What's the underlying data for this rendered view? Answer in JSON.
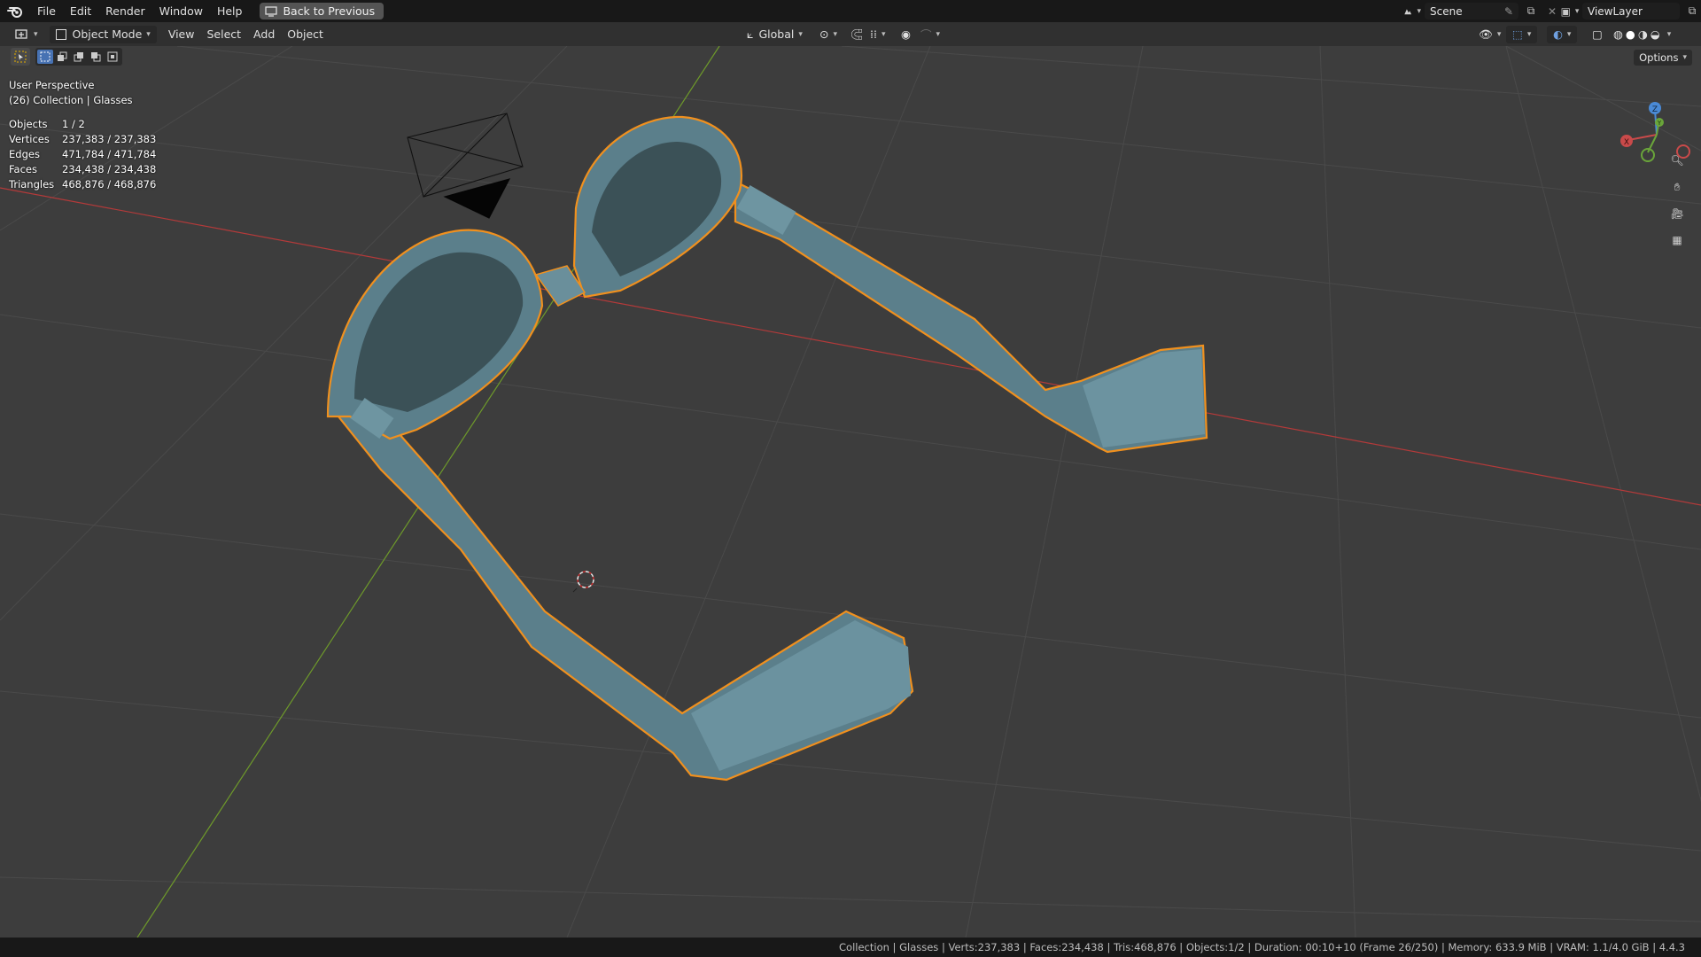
{
  "topbar": {
    "menu": [
      "File",
      "Edit",
      "Render",
      "Window",
      "Help"
    ],
    "back_label": "Back to Previous",
    "scene_label": "Scene",
    "viewlayer_label": "ViewLayer"
  },
  "header": {
    "mode_label": "Object Mode",
    "menus": [
      "View",
      "Select",
      "Add",
      "Object"
    ],
    "transform_orientation": "Global",
    "options_label": "Options"
  },
  "overlay": {
    "perspective": "User Perspective",
    "collection": "(26) Collection | Glasses",
    "stats": [
      {
        "key": "Objects",
        "value": "1 / 2"
      },
      {
        "key": "Vertices",
        "value": "237,383 / 237,383"
      },
      {
        "key": "Edges",
        "value": "471,784 / 471,784"
      },
      {
        "key": "Faces",
        "value": "234,438 / 234,438"
      },
      {
        "key": "Triangles",
        "value": "468,876 / 468,876"
      }
    ]
  },
  "gizmo": {
    "x_label": "X",
    "y_label": "Y",
    "z_label": "Z"
  },
  "status": {
    "text": "Collection | Glasses | Verts:237,383 | Faces:234,438 | Tris:468,876 | Objects:1/2 | Duration: 00:10+10 (Frame 26/250) | Memory: 633.9 MiB | VRAM: 1.1/4.0 GiB | 4.4.3"
  },
  "colors": {
    "viewport_bg": "#3d3d3d",
    "x_axis": "#c0392b",
    "y_axis": "#6a9a2a",
    "selection_outline": "#f0901e",
    "mesh": "#5f8592",
    "active_blue": "#4772b3"
  }
}
